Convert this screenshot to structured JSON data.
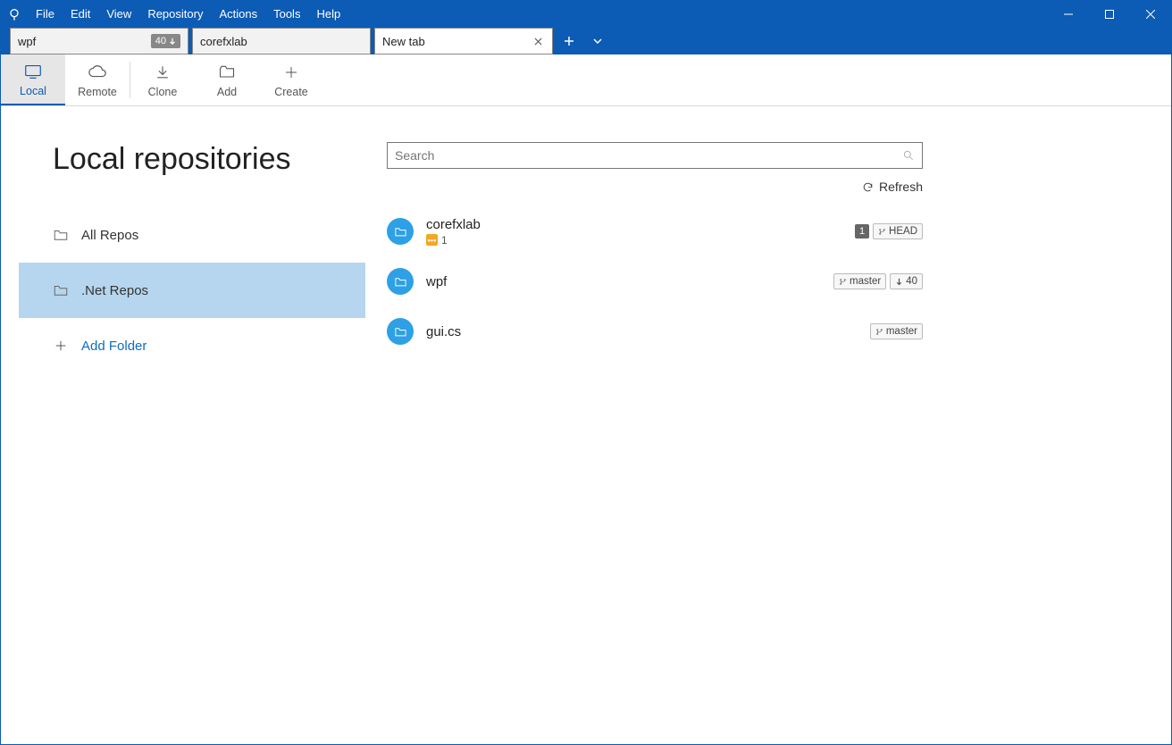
{
  "menu": {
    "items": [
      "File",
      "Edit",
      "View",
      "Repository",
      "Actions",
      "Tools",
      "Help"
    ]
  },
  "tabs": [
    {
      "label": "wpf",
      "badge_count": "40",
      "has_down_arrow": true,
      "closable": false
    },
    {
      "label": "corefxlab",
      "closable": false
    },
    {
      "label": "New tab",
      "active": true,
      "closable": true
    }
  ],
  "toolbar": {
    "local": "Local",
    "remote": "Remote",
    "clone": "Clone",
    "add": "Add",
    "create": "Create"
  },
  "page": {
    "title": "Local repositories"
  },
  "sidebar": {
    "all_repos": "All Repos",
    "net_repos": ".Net Repos",
    "add_folder": "Add Folder"
  },
  "search": {
    "placeholder": "Search"
  },
  "refresh_label": "Refresh",
  "repos": [
    {
      "name": "corefxlab",
      "stash_count": "1",
      "count_badge": "1",
      "branch": "HEAD"
    },
    {
      "name": "wpf",
      "branch": "master",
      "behind": "40"
    },
    {
      "name": "gui.cs",
      "branch": "master"
    }
  ]
}
